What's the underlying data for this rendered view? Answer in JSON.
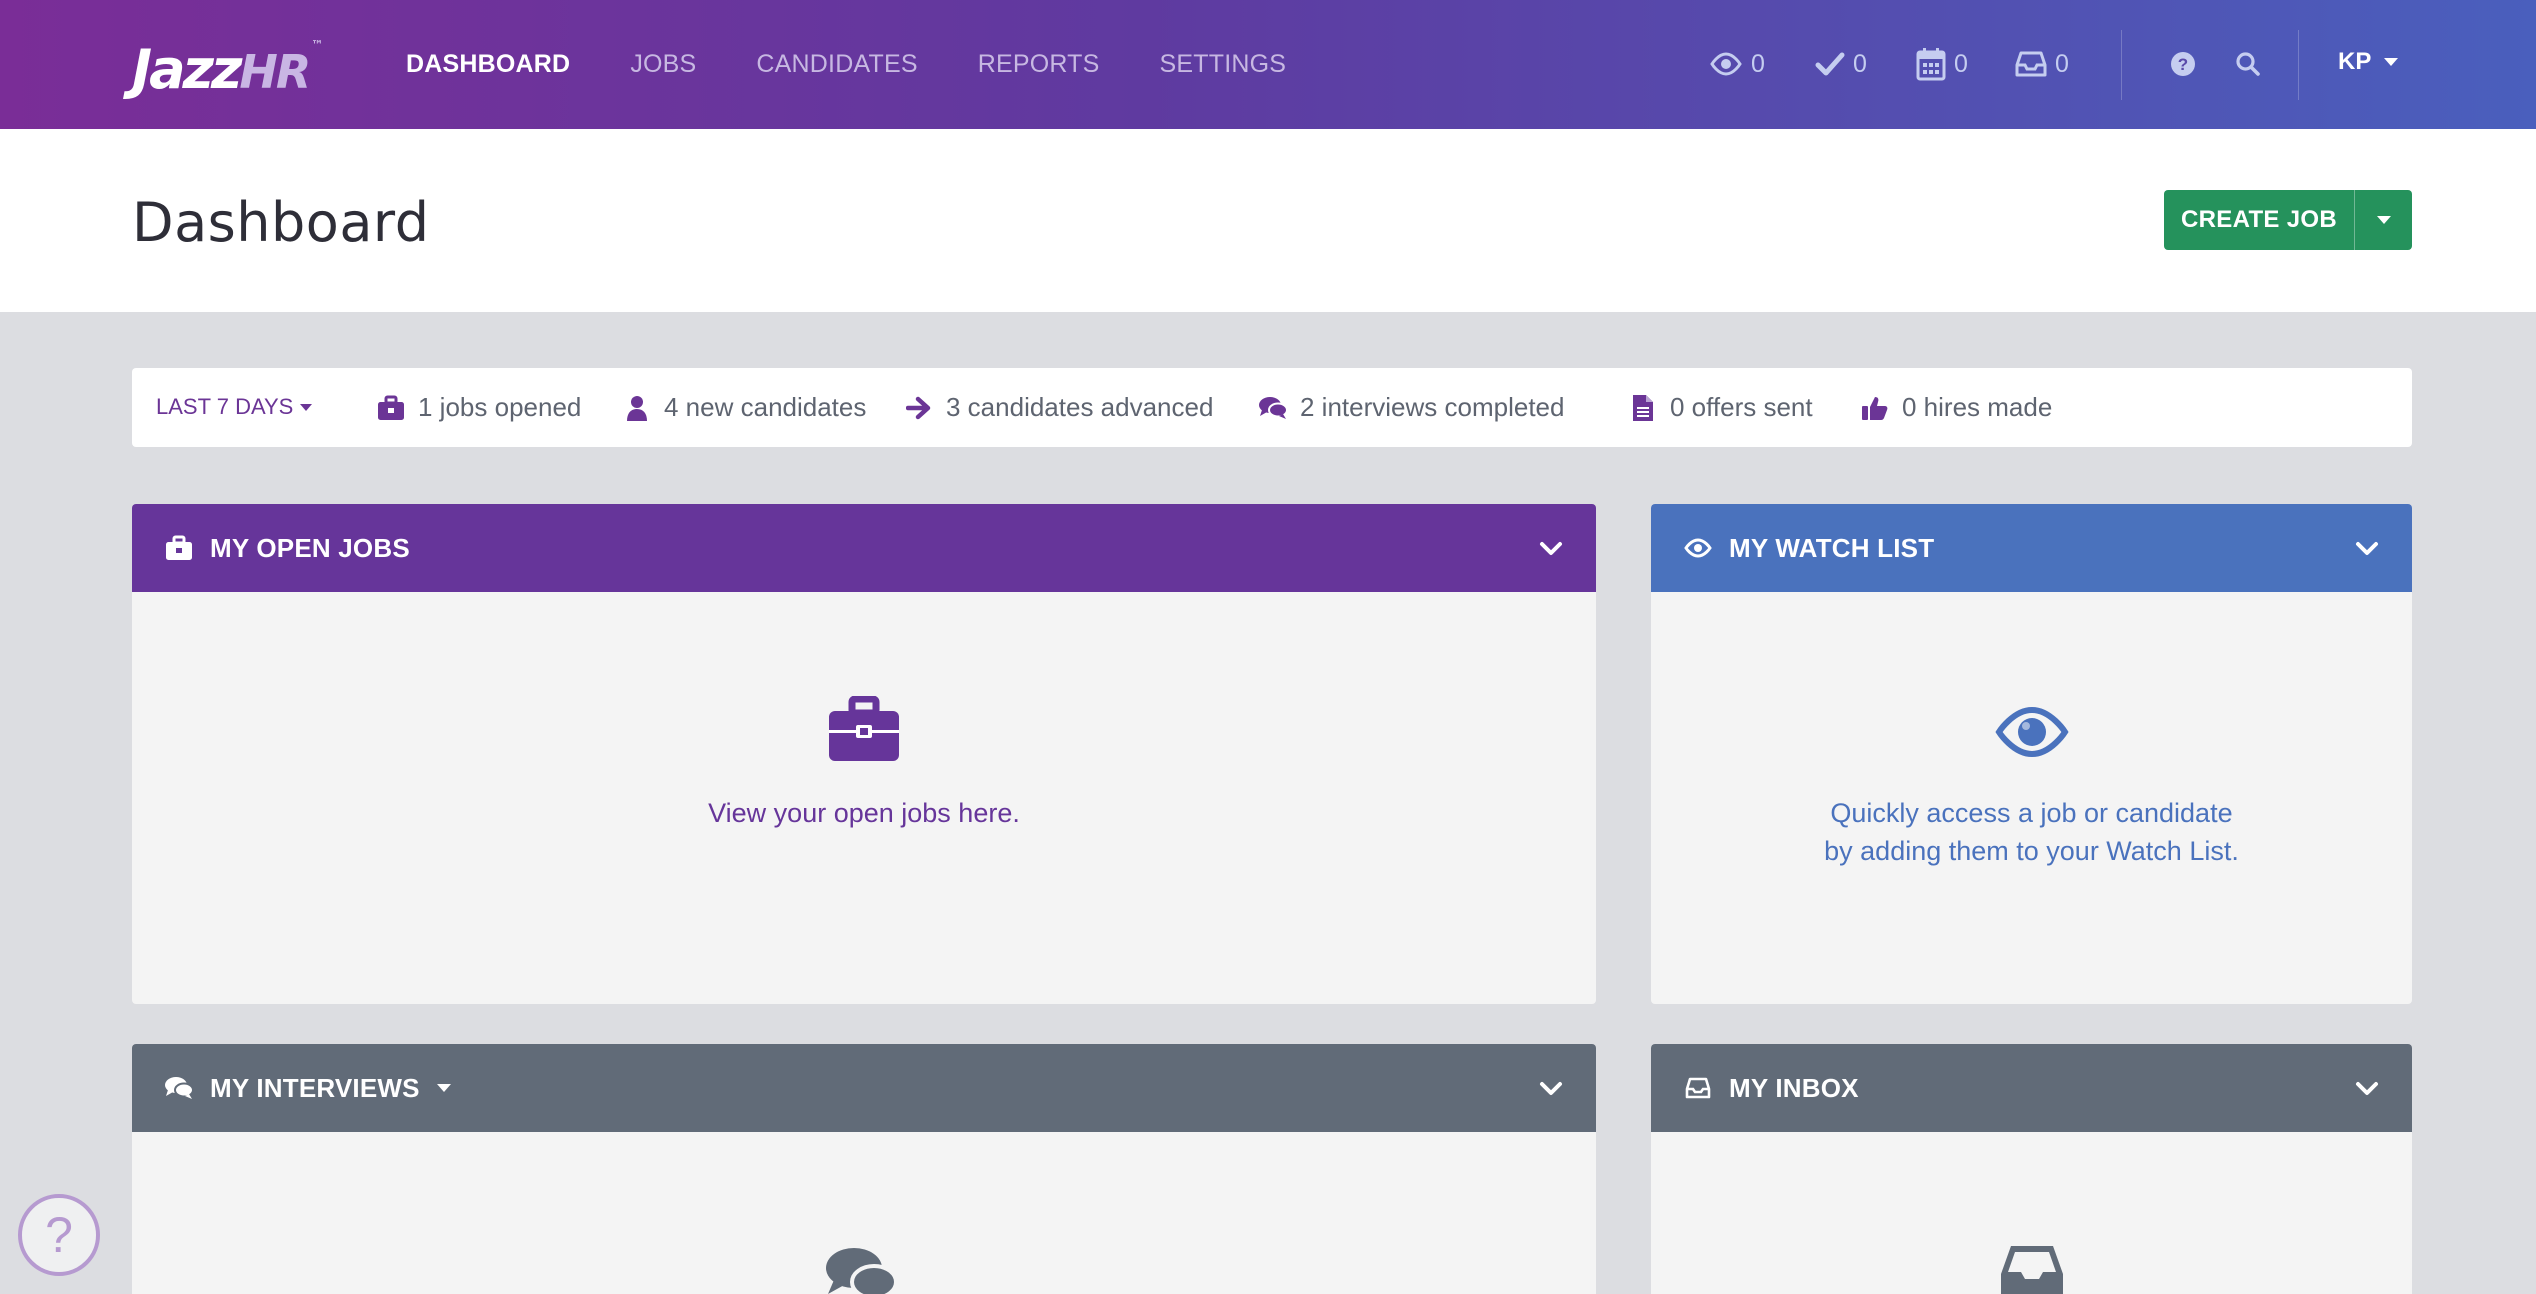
{
  "brand": {
    "logo_main": "Jazz",
    "logo_accent": "HR",
    "logo_tm": "™"
  },
  "nav": {
    "links": [
      "DASHBOARD",
      "JOBS",
      "CANDIDATES",
      "REPORTS",
      "SETTINGS"
    ],
    "active": "DASHBOARD"
  },
  "top_stats": {
    "watch_count": "0",
    "approvals_count": "0",
    "calendar_count": "0",
    "inbox_count": "0"
  },
  "user": {
    "initials": "KP"
  },
  "header": {
    "title": "Dashboard",
    "create_job_label": "CREATE JOB"
  },
  "stats_bar": {
    "range_label": "LAST 7 DAYS",
    "items": [
      {
        "icon": "briefcase-icon",
        "text": "1 jobs opened"
      },
      {
        "icon": "user-icon",
        "text": "4 new candidates"
      },
      {
        "icon": "arrow-right-icon",
        "text": "3 candidates advanced"
      },
      {
        "icon": "comments-icon",
        "text": "2 interviews completed"
      },
      {
        "icon": "document-icon",
        "text": "0 offers sent"
      },
      {
        "icon": "thumbs-up-icon",
        "text": "0 hires made"
      }
    ]
  },
  "panels": {
    "open_jobs": {
      "title": "MY OPEN JOBS",
      "message": "View your open jobs here."
    },
    "watch_list": {
      "title": "MY WATCH LIST",
      "message_line1": "Quickly access a job or candidate",
      "message_line2": "by adding them to your Watch List."
    },
    "interviews": {
      "title": "MY INTERVIEWS"
    },
    "inbox": {
      "title": "MY INBOX"
    }
  },
  "colors": {
    "purple": "#66359a",
    "blue": "#4a72bd",
    "slate": "#616b78",
    "green": "#25925c"
  },
  "help": {
    "label": "?"
  }
}
